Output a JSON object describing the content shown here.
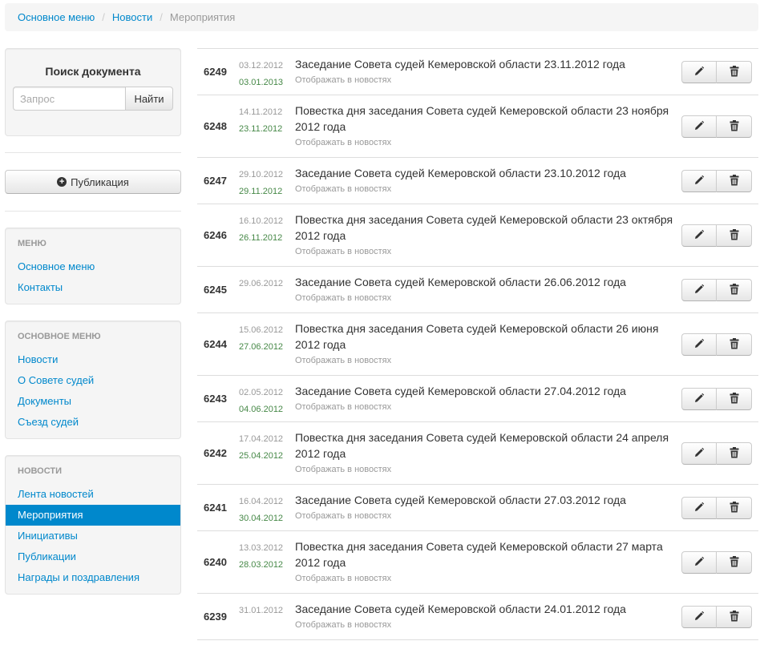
{
  "breadcrumb": {
    "items": [
      "Основное меню",
      "Новости"
    ],
    "separator": "/",
    "current": "Мероприятия"
  },
  "search": {
    "title": "Поиск документа",
    "placeholder": "Запрос",
    "button": "Найти"
  },
  "publish_button": "Публикация",
  "menu": {
    "header": "Меню",
    "items": [
      "Основное меню",
      "Контакты"
    ]
  },
  "main_menu": {
    "header": "Основное меню",
    "items": [
      "Новости",
      "О Совете судей",
      "Документы",
      "Съезд судей"
    ]
  },
  "news_menu": {
    "header": "Новости",
    "items": [
      "Лента новостей",
      "Мероприятия",
      "Инициативы",
      "Публикации",
      "Награды и поздравления"
    ],
    "active": "Мероприятия"
  },
  "rows": [
    {
      "id": "6249",
      "date_created": "03.12.2012",
      "date_published": "03.01.2013",
      "title": "Заседание Совета судей Кемеровской области 23.11.2012 года",
      "status": "Отображать в новостях"
    },
    {
      "id": "6248",
      "date_created": "14.11.2012",
      "date_published": "23.11.2012",
      "title": "Повестка дня заседания Совета судей Кемеровской области 23 ноября 2012 года",
      "status": "Отображать в новостях"
    },
    {
      "id": "6247",
      "date_created": "29.10.2012",
      "date_published": "29.11.2012",
      "title": "Заседание Совета судей Кемеровской области 23.10.2012 года",
      "status": "Отображать в новостях"
    },
    {
      "id": "6246",
      "date_created": "16.10.2012",
      "date_published": "26.11.2012",
      "title": "Повестка дня заседания Совета судей Кемеровской области 23 октября 2012 года",
      "status": "Отображать в новостях"
    },
    {
      "id": "6245",
      "date_created": "29.06.2012",
      "date_published": "",
      "title": "Заседание Совета судей Кемеровской области 26.06.2012 года",
      "status": "Отображать в новостях"
    },
    {
      "id": "6244",
      "date_created": "15.06.2012",
      "date_published": "27.06.2012",
      "title": "Повестка дня заседания Совета судей Кемеровской области 26 июня 2012 года",
      "status": "Отображать в новостях"
    },
    {
      "id": "6243",
      "date_created": "02.05.2012",
      "date_published": "04.06.2012",
      "title": "Заседание Совета судей Кемеровской области 27.04.2012 года",
      "status": "Отображать в новостях"
    },
    {
      "id": "6242",
      "date_created": "17.04.2012",
      "date_published": "25.04.2012",
      "title": "Повестка дня заседания Совета судей Кемеровской области 24 апреля 2012 года",
      "status": "Отображать в новостях"
    },
    {
      "id": "6241",
      "date_created": "16.04.2012",
      "date_published": "30.04.2012",
      "title": "Заседание Совета судей Кемеровской области 27.03.2012 года",
      "status": "Отображать в новостях"
    },
    {
      "id": "6240",
      "date_created": "13.03.2012",
      "date_published": "28.03.2012",
      "title": "Повестка дня заседания Совета судей Кемеровской области 27 марта 2012 года",
      "status": "Отображать в новостях"
    },
    {
      "id": "6239",
      "date_created": "31.01.2012",
      "date_published": "",
      "title": "Заседание Совета судей Кемеровской области 24.01.2012 года",
      "status": "Отображать в новостях"
    }
  ],
  "icons": {
    "edit": "pencil-icon",
    "delete": "trash-icon",
    "publish": "plus-circle-icon"
  }
}
